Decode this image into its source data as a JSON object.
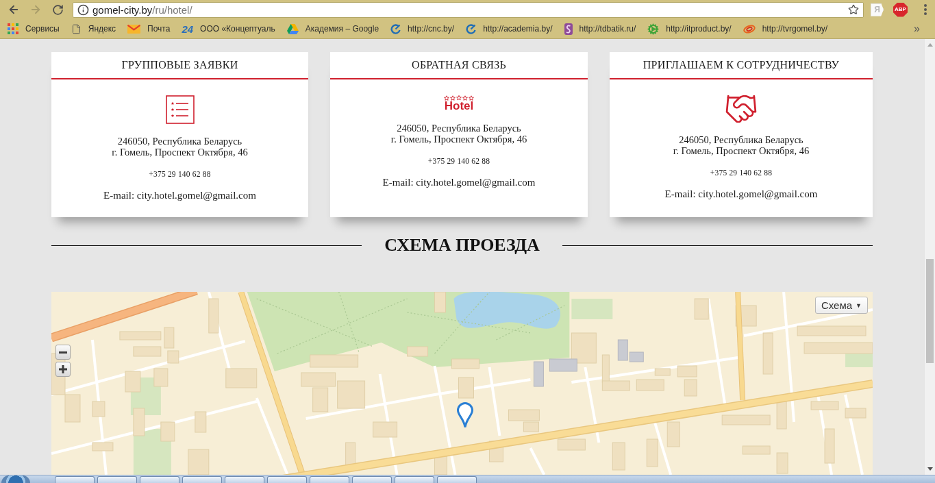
{
  "browser": {
    "back_disabled": false,
    "forward_disabled": true,
    "url_host": "gomel-city.by",
    "url_path": "/ru/hotel/",
    "extension_buttons": [
      {
        "kind": "flag",
        "label": "Я"
      },
      {
        "kind": "octagon",
        "label": "ABP"
      }
    ]
  },
  "bookmarks": [
    {
      "label": "Сервисы"
    },
    {
      "label": "Яндекс"
    },
    {
      "label": "Почта"
    },
    {
      "label": "ООО «Концептуаль",
      "icon_text": "24"
    },
    {
      "label": "Академия – Google"
    },
    {
      "label": "http://cnc.by/"
    },
    {
      "label": "http://academia.by/"
    },
    {
      "label": "http://tdbatik.ru/"
    },
    {
      "label": "http://itproduct.by/"
    },
    {
      "label": "http://tvrgomel.by/"
    }
  ],
  "bookmarks_overflow": "»",
  "cards": [
    {
      "title": "ГРУППОВЫЕ ЗАЯВКИ",
      "address_lines": [
        "246050, Республика Беларусь",
        "г. Гомель, Проспект Октября, 46"
      ],
      "phone": "+375 29 140 62 88",
      "email": "E-mail: city.hotel.gomel@gmail.com"
    },
    {
      "title": "ОБРАТНАЯ СВЯЗЬ",
      "logo_text": "Hotel",
      "address_lines": [
        "246050, Республика Беларусь",
        "г. Гомель, Проспект Октября, 46"
      ],
      "phone": "+375 29 140 62 88",
      "email": "E-mail: city.hotel.gomel@gmail.com"
    },
    {
      "title": "ПРИГЛАШАЕМ К СОТРУДНИЧЕСТВУ",
      "address_lines": [
        "246050, Республика Беларусь",
        "г. Гомель, Проспект Октября, 46"
      ],
      "phone": "+375 29 140 62 88",
      "email": "E-mail: city.hotel.gomel@gmail.com"
    }
  ],
  "route_heading": "СХЕМА ПРОЕЗДА",
  "map": {
    "type_button": {
      "label": "Схема",
      "caret": "▼"
    }
  }
}
